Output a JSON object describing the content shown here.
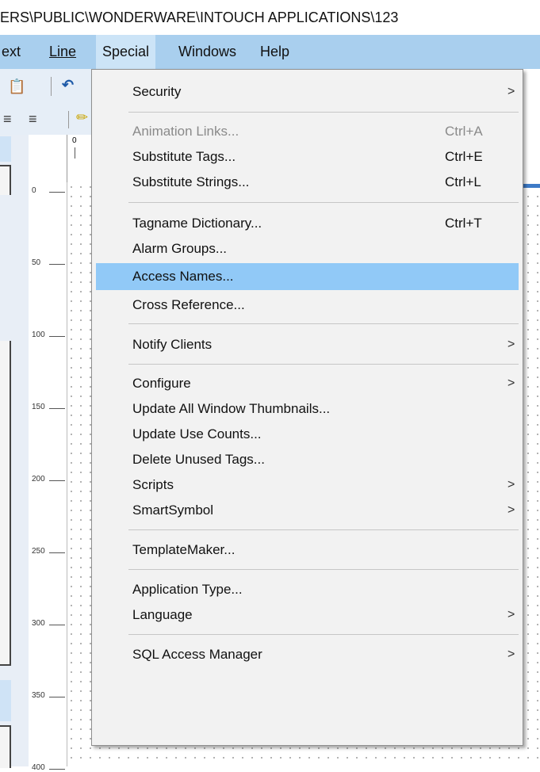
{
  "window": {
    "title": "ERS\\PUBLIC\\WONDERWARE\\INTOUCH APPLICATIONS\\123"
  },
  "menubar": {
    "items": [
      {
        "label": "ext"
      },
      {
        "label": "Line"
      },
      {
        "label": "Special"
      },
      {
        "label": "Windows"
      },
      {
        "label": "Help"
      }
    ]
  },
  "ruler": {
    "top_label": "0",
    "ticks": [
      "0",
      "50",
      "100",
      "150",
      "200",
      "250",
      "300",
      "350",
      "400"
    ]
  },
  "special_menu": {
    "items": [
      {
        "label": "Security",
        "shortcut": "",
        "submenu": true,
        "disabled": false
      },
      {
        "label": "Animation Links...",
        "shortcut": "Ctrl+A",
        "submenu": false,
        "disabled": true
      },
      {
        "label": "Substitute Tags...",
        "shortcut": "Ctrl+E",
        "submenu": false,
        "disabled": false
      },
      {
        "label": "Substitute Strings...",
        "shortcut": "Ctrl+L",
        "submenu": false,
        "disabled": false
      },
      {
        "label": "Tagname Dictionary...",
        "shortcut": "Ctrl+T",
        "submenu": false,
        "disabled": false
      },
      {
        "label": "Alarm Groups...",
        "shortcut": "",
        "submenu": false,
        "disabled": false
      },
      {
        "label": "Access Names...",
        "shortcut": "",
        "submenu": false,
        "disabled": false,
        "highlighted": true
      },
      {
        "label": "Cross Reference...",
        "shortcut": "",
        "submenu": false,
        "disabled": false
      },
      {
        "label": "Notify Clients",
        "shortcut": "",
        "submenu": true,
        "disabled": false
      },
      {
        "label": "Configure",
        "shortcut": "",
        "submenu": true,
        "disabled": false
      },
      {
        "label": "Update All Window Thumbnails...",
        "shortcut": "",
        "submenu": false,
        "disabled": false
      },
      {
        "label": "Update Use Counts...",
        "shortcut": "",
        "submenu": false,
        "disabled": false
      },
      {
        "label": "Delete Unused Tags...",
        "shortcut": "",
        "submenu": false,
        "disabled": false
      },
      {
        "label": "Scripts",
        "shortcut": "",
        "submenu": true,
        "disabled": false
      },
      {
        "label": "SmartSymbol",
        "shortcut": "",
        "submenu": true,
        "disabled": false
      },
      {
        "label": "TemplateMaker...",
        "shortcut": "",
        "submenu": false,
        "disabled": false
      },
      {
        "label": "Application Type...",
        "shortcut": "",
        "submenu": false,
        "disabled": false
      },
      {
        "label": "Language",
        "shortcut": "",
        "submenu": true,
        "disabled": false
      },
      {
        "label": "SQL Access Manager",
        "shortcut": "",
        "submenu": true,
        "disabled": false
      }
    ],
    "submenu_arrow": ">",
    "highlight_color": "#91c9f7"
  },
  "colors": {
    "menubar": "#a9cfee",
    "menu_bg": "#f2f2f2"
  }
}
